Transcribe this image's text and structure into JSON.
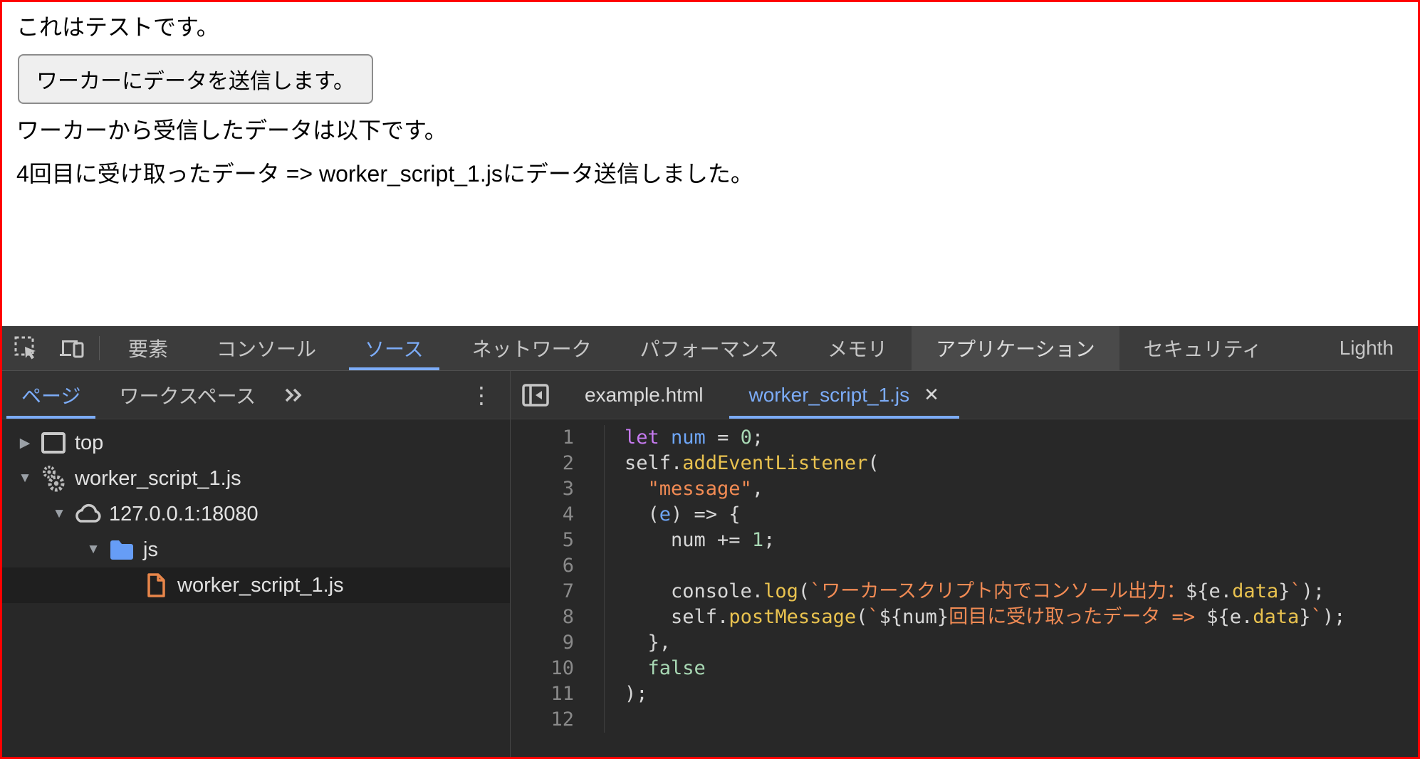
{
  "colors": {
    "screenshot_border": "#ff0000",
    "accent_blue": "#7cacf8",
    "toolbar_bg": "#3c3c3c",
    "subheader_bg": "#333333",
    "editor_bg": "#282828",
    "selected_row_bg": "#1f1f1f",
    "token_keyword": "#c67af0",
    "token_variable_def": "#6ea6f8",
    "token_number": "#a8d8b4",
    "token_property": "#e9c24f",
    "token_string": "#f28b54",
    "folder_icon_blue": "#669df6",
    "file_icon_orange": "#e8864a",
    "button_bg": "#efefef",
    "button_border": "#8c8c8c"
  },
  "webpage": {
    "line1": "これはテストです。",
    "button_label": "ワーカーにデータを送信します。",
    "line2": "ワーカーから受信したデータは以下です。",
    "line3": "4回目に受け取ったデータ => worker_script_1.jsにデータ送信しました。"
  },
  "devtools": {
    "main_tabs": [
      {
        "label": "要素"
      },
      {
        "label": "コンソール"
      },
      {
        "label": "ソース",
        "active": true
      },
      {
        "label": "ネットワーク"
      },
      {
        "label": "パフォーマンス"
      },
      {
        "label": "メモリ"
      },
      {
        "label": "アプリケーション",
        "hover": true
      },
      {
        "label": "セキュリティ"
      },
      {
        "label": "Lighth",
        "clipped": true,
        "pushed_right": true
      }
    ],
    "navigator": {
      "tabs": [
        {
          "label": "ページ",
          "active": true
        },
        {
          "label": "ワークスペース"
        }
      ],
      "more_tabs_icon": "double-chevron-right",
      "menu_icon": "vertical-dots"
    },
    "tree": [
      {
        "depth": 0,
        "expander": "collapsed",
        "icon": "frame",
        "label": "top"
      },
      {
        "depth": 0,
        "expander": "expanded",
        "icon": "gears",
        "label": "worker_script_1.js"
      },
      {
        "depth": 1,
        "expander": "expanded",
        "icon": "cloud",
        "label": "127.0.0.1:18080"
      },
      {
        "depth": 2,
        "expander": "expanded",
        "icon": "folder",
        "label": "js"
      },
      {
        "depth": 3,
        "expander": "none",
        "icon": "file",
        "label": "worker_script_1.js",
        "selected": true
      }
    ],
    "editor": {
      "tabs": [
        {
          "label": "example.html"
        },
        {
          "label": "worker_script_1.js",
          "active": true,
          "closable": true,
          "close_icon": "✕"
        }
      ],
      "code_lines": [
        {
          "num": "1",
          "tokens": [
            [
              "k",
              "let"
            ],
            [
              "p",
              " "
            ],
            [
              "d",
              "num"
            ],
            [
              "p",
              " = "
            ],
            [
              "n",
              "0"
            ],
            [
              "p",
              ";"
            ]
          ]
        },
        {
          "num": "2",
          "tokens": [
            [
              "p",
              "self."
            ],
            [
              "f",
              "addEventListener"
            ],
            [
              "p",
              "("
            ]
          ]
        },
        {
          "num": "3",
          "tokens": [
            [
              "p",
              "  "
            ],
            [
              "s",
              "\"message\""
            ],
            [
              "p",
              ","
            ]
          ]
        },
        {
          "num": "4",
          "tokens": [
            [
              "p",
              "  ("
            ],
            [
              "d",
              "e"
            ],
            [
              "p",
              ") => {"
            ]
          ]
        },
        {
          "num": "5",
          "tokens": [
            [
              "p",
              "    num += "
            ],
            [
              "n",
              "1"
            ],
            [
              "p",
              ";"
            ]
          ]
        },
        {
          "num": "6",
          "tokens": []
        },
        {
          "num": "7",
          "tokens": [
            [
              "p",
              "    console."
            ],
            [
              "f",
              "log"
            ],
            [
              "p",
              "("
            ],
            [
              "s",
              "`ワーカースクリプト内でコンソール出力："
            ],
            [
              "p",
              "${e."
            ],
            [
              "f",
              "data"
            ],
            [
              "p",
              "}"
            ],
            [
              "s",
              "`"
            ],
            [
              "p",
              ");"
            ]
          ]
        },
        {
          "num": "8",
          "tokens": [
            [
              "p",
              "    self."
            ],
            [
              "f",
              "postMessage"
            ],
            [
              "p",
              "("
            ],
            [
              "s",
              "`"
            ],
            [
              "p",
              "${num}"
            ],
            [
              "s",
              "回目に受け取ったデータ => "
            ],
            [
              "p",
              "${e."
            ],
            [
              "f",
              "data"
            ],
            [
              "p",
              "}"
            ],
            [
              "s",
              "`"
            ],
            [
              "p",
              ");"
            ]
          ]
        },
        {
          "num": "9",
          "tokens": [
            [
              "p",
              "  },"
            ]
          ]
        },
        {
          "num": "10",
          "tokens": [
            [
              "p",
              "  "
            ],
            [
              "n",
              "false"
            ]
          ]
        },
        {
          "num": "11",
          "tokens": [
            [
              "p",
              ");"
            ]
          ]
        },
        {
          "num": "12",
          "tokens": []
        }
      ]
    }
  }
}
